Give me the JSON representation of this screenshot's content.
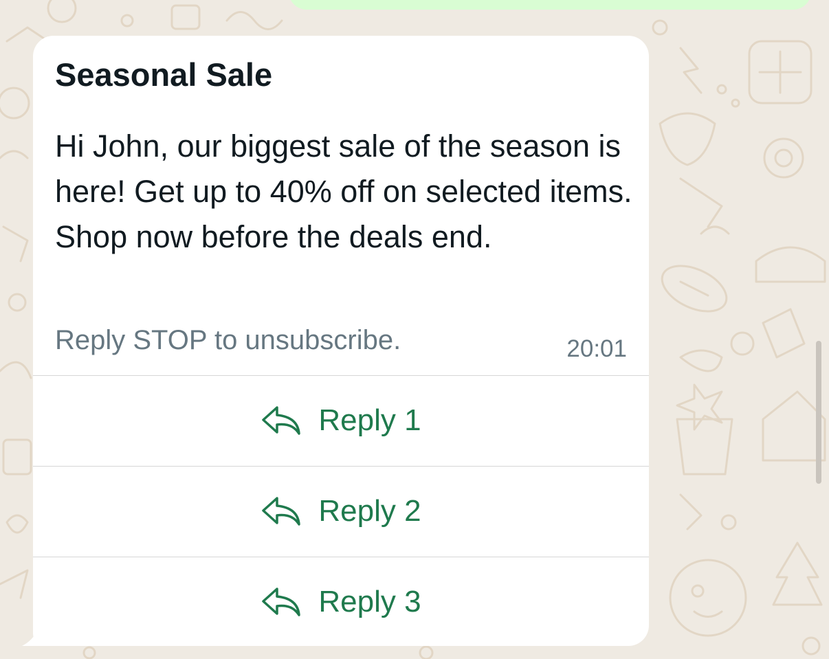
{
  "message": {
    "title": "Seasonal Sale",
    "body": "Hi John, our biggest sale of the season is here! Get up to 40% off on selected items. Shop now before the deals end.",
    "footer": "Reply STOP to unsubscribe.",
    "time": "20:01"
  },
  "quick_replies": [
    {
      "label": "Reply 1",
      "icon": "reply-arrow-icon"
    },
    {
      "label": "Reply 2",
      "icon": "reply-arrow-icon"
    },
    {
      "label": "Reply 3",
      "icon": "reply-arrow-icon"
    }
  ],
  "colors": {
    "chat_background": "#efeae2",
    "bubble": "#ffffff",
    "sent_bubble": "#d9fdd3",
    "reply_accent": "#1f7a4d",
    "secondary_text": "#667781"
  }
}
